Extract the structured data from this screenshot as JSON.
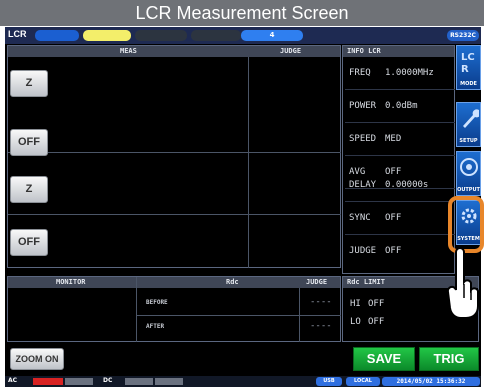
{
  "caption": "LCR Measurement Screen",
  "toolbar": {
    "mode_label": "LCR",
    "center_label": "4",
    "rs232c_label": "RS232C"
  },
  "meas_panel": {
    "meas_header": "MEAS",
    "judge_header": "JUDGE",
    "buttons": [
      "Z",
      "OFF",
      "Z",
      "OFF"
    ]
  },
  "info_panel": {
    "header": "INFO LCR",
    "rows": [
      {
        "label": "FREQ",
        "value": "1.0000MHz"
      },
      {
        "label": "POWER",
        "value": "0.0dBm"
      },
      {
        "label": "SPEED",
        "value": "MED"
      },
      {
        "label": "AVG",
        "value": "OFF"
      },
      {
        "label": "DELAY",
        "value": "0.00000s"
      },
      {
        "label": "SYNC",
        "value": "OFF"
      },
      {
        "label": "JUDGE",
        "value": "OFF"
      }
    ]
  },
  "side_buttons": {
    "mode": "MODE",
    "setup": "SETUP",
    "output": "OUTPUT",
    "system": "SYSTEM"
  },
  "monitor_panel": {
    "monitor_header": "MONITOR",
    "rdc_header": "Rdc",
    "judge_header": "JUDGE",
    "before_label": "BEFORE",
    "after_label": "AFTER",
    "before_judge": "----",
    "after_judge": "----"
  },
  "rdc_limit": {
    "header": "Rdc LIMIT",
    "hi_label": "HI",
    "hi_value": "OFF",
    "lo_label": "LO",
    "lo_value": "OFF"
  },
  "bottom": {
    "zoom_label": "ZOOM ON",
    "save_label": "SAVE",
    "trig_label": "TRIG"
  },
  "status_bar": {
    "ac_label": "AC",
    "dc_label": "DC",
    "usb_label": "USB",
    "local_label": "LOCAL",
    "datetime": "2014/05/02 15:36:32"
  },
  "colors": {
    "highlight_border": "#e8862a",
    "accent_blue": "#1e6ed0",
    "save_green": "#15a83a"
  },
  "icons": {
    "cursor": "hand-pointer-icon"
  }
}
